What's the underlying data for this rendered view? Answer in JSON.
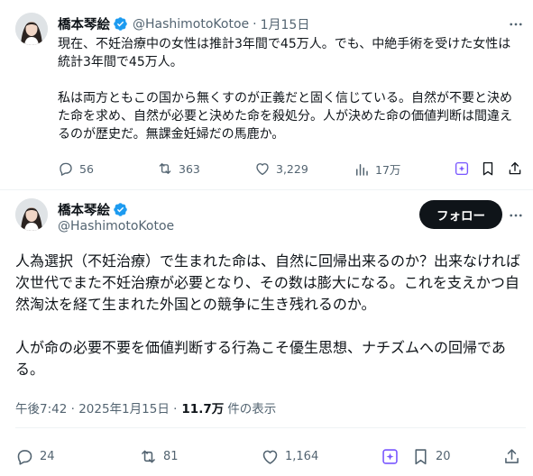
{
  "quoted_tweet": {
    "display_name": "橋本琴絵",
    "handle": "@HashimotoKotoe",
    "separator": "·",
    "date": "1月15日",
    "text": "現在、不妊治療中の女性は推計3年間で45万人。でも、中絶手術を受けた女性は統計3年間で45万人。\n\n私は両方ともこの国から無くすのが正義だと固く信じている。自然が不要と決めた命を求め、自然が必要と決めた命を殺処分。人が決めた命の価値判断は間違えるのが歴史だ。無課金妊婦だの馬鹿か。",
    "replies": "56",
    "reposts": "363",
    "likes": "3,229",
    "views": "17万"
  },
  "main_tweet": {
    "display_name": "橋本琴絵",
    "handle": "@HashimotoKotoe",
    "follow_label": "フォロー",
    "text": "人為選択（不妊治療）で生まれた命は、自然に回帰出来るのか？出来なければ次世代でまた不妊治療が必要となり、その数は膨大になる。これを支えかつ自然淘汰を経て生まれた外国との競争に生き残れるのか。\n\n人が命の必要不要を価値判断する行為こそ優生思想、ナチズムへの回帰である。",
    "timestamp": "午後7:42 · 2025年1月15日 ·",
    "views_count": "11.7万",
    "views_label": "件の表示",
    "replies": "24",
    "reposts": "81",
    "likes": "1,164",
    "bookmarks": "20"
  },
  "colors": {
    "verified": "#1d9bf0",
    "text": "#0f1419",
    "muted": "#536471",
    "grok": "#7856ff"
  }
}
